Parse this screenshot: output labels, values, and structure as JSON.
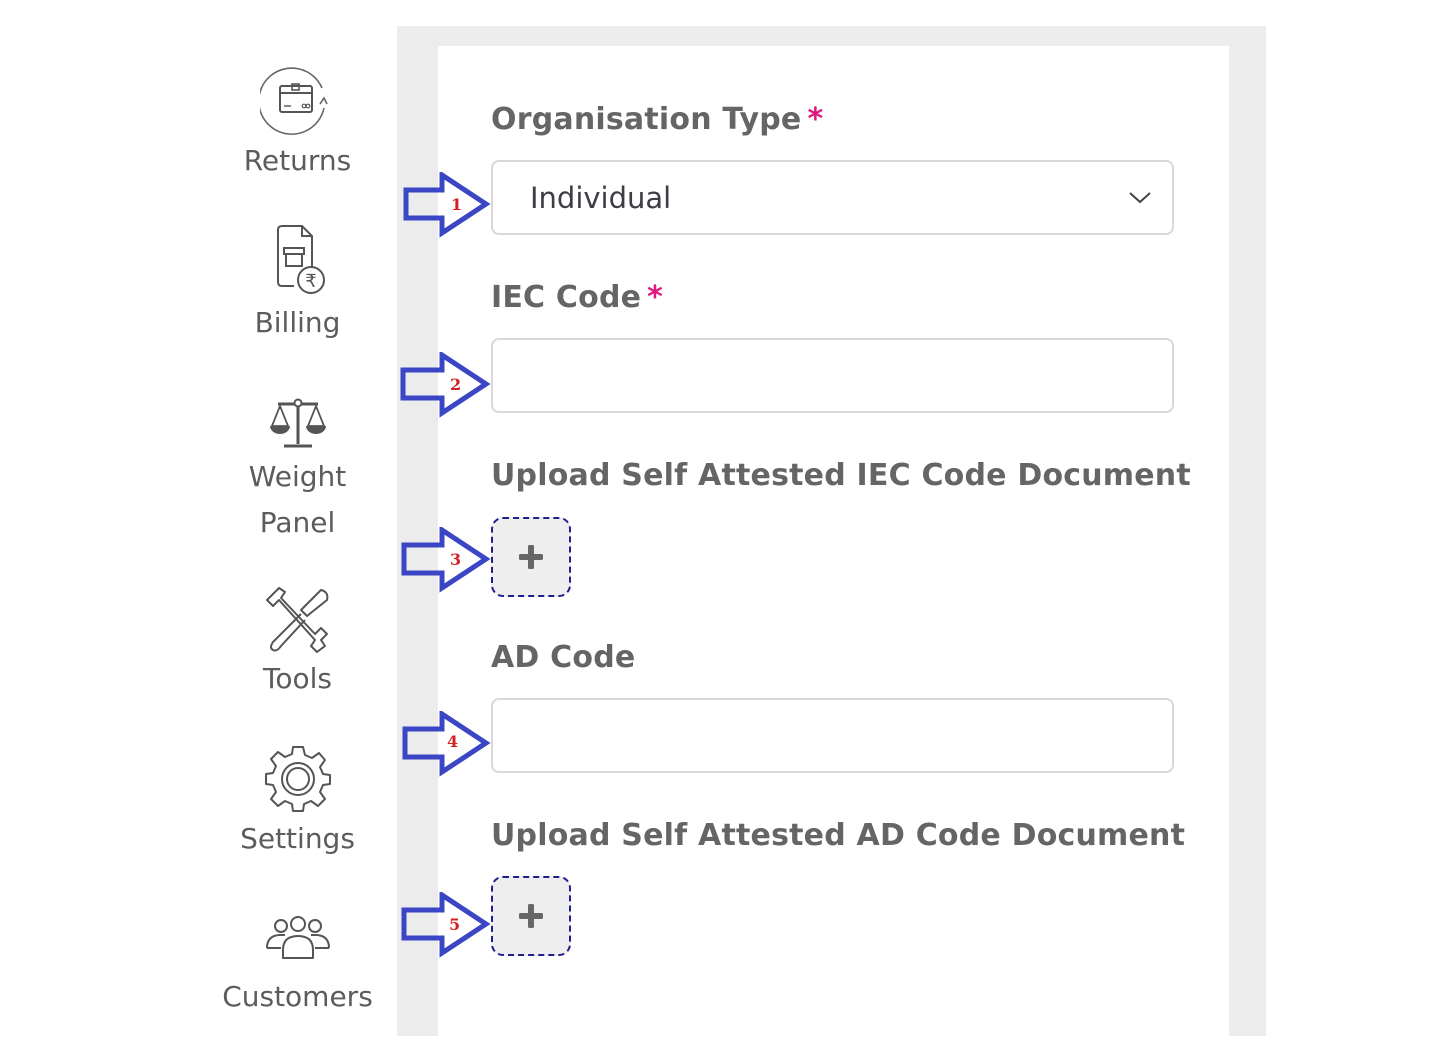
{
  "sidebar": {
    "items": [
      {
        "label": "Returns",
        "icon": "returns-box-icon"
      },
      {
        "label": "Billing",
        "icon": "billing-invoice-icon"
      },
      {
        "label": "Weight Panel",
        "label_lines": [
          "Weight",
          "Panel"
        ],
        "icon": "scale-icon"
      },
      {
        "label": "Tools",
        "icon": "tools-icon"
      },
      {
        "label": "Settings",
        "icon": "gear-icon"
      },
      {
        "label": "Customers",
        "icon": "users-icon"
      }
    ]
  },
  "form": {
    "organisation_type": {
      "label": "Organisation Type",
      "required_mark": "*",
      "value": "Individual"
    },
    "iec_code": {
      "label": "IEC Code",
      "required_mark": "*",
      "value": ""
    },
    "iec_document": {
      "label": "Upload Self Attested IEC Code Document",
      "button_icon": "+"
    },
    "ad_code": {
      "label": "AD Code",
      "value": ""
    },
    "ad_document": {
      "label": "Upload Self Attested AD Code Document",
      "button_icon": "+"
    }
  },
  "annotations": {
    "arrows": [
      "1",
      "2",
      "3",
      "4",
      "5"
    ],
    "arrow_color": "#3a46c4",
    "number_color": "#d42020"
  },
  "colors": {
    "required": "#e0177d",
    "upload_border": "#1d1f8f",
    "panel_bg": "#ececec"
  }
}
